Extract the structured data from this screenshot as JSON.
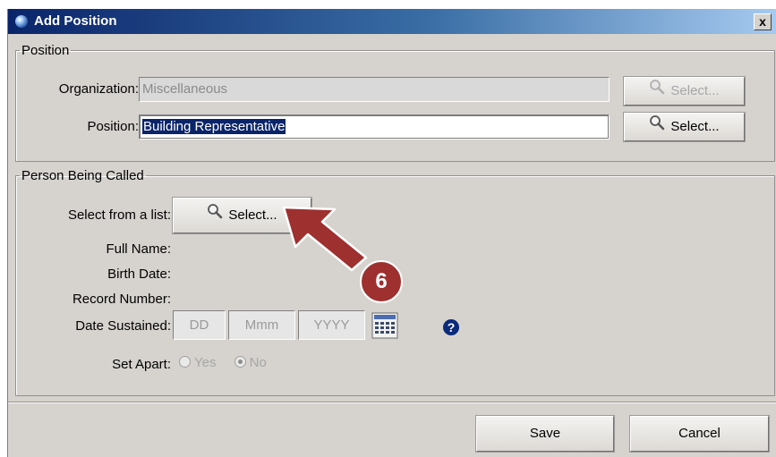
{
  "dialog": {
    "title": "Add Position",
    "close_label": "x"
  },
  "position_group": {
    "legend": "Position",
    "organization_label": "Organization:",
    "organization_value": "Miscellaneous",
    "position_label": "Position:",
    "position_value": "Building Representative",
    "select_label": "Select..."
  },
  "person_group": {
    "legend": "Person Being Called",
    "select_from_list_label": "Select from a list:",
    "select_label": "Select...",
    "full_name_label": "Full Name:",
    "birth_date_label": "Birth Date:",
    "record_number_label": "Record Number:",
    "date_sustained_label": "Date Sustained:",
    "date_placeholders": {
      "day": "DD",
      "month": "Mmm",
      "year": "YYYY"
    },
    "set_apart_label": "Set Apart:",
    "set_apart_options": [
      "Yes",
      "No"
    ],
    "set_apart_selected": "No"
  },
  "annotation": {
    "step_number": "6"
  },
  "footer": {
    "save_label": "Save",
    "cancel_label": "Cancel"
  },
  "icons": {
    "app": "globe-icon",
    "close": "close-icon",
    "search": "magnifier-icon",
    "calendar": "calendar-icon",
    "help": "help-icon",
    "arrow": "callout-arrow-icon"
  },
  "colors": {
    "titlebar": "#0a246a",
    "dialog_bg": "#d6d3ce",
    "selection": "#0a246a",
    "callout": "#9e3030",
    "help": "#0a2a7a"
  }
}
